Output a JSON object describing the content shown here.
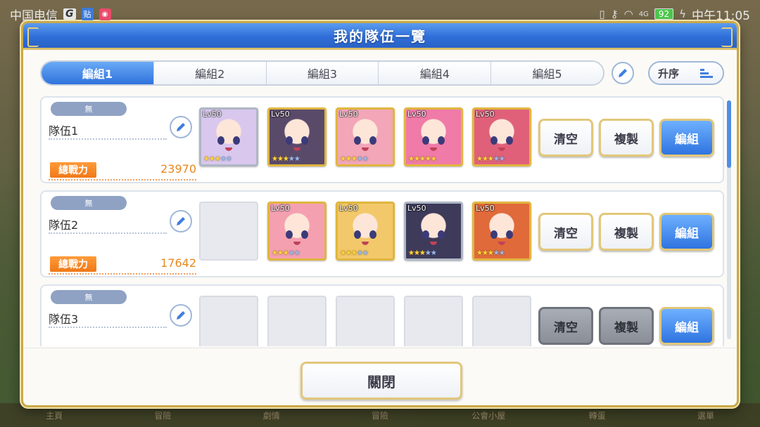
{
  "status_bar": {
    "carrier": "中国电信",
    "carrier_badge": "G",
    "tieba_badge": "贴",
    "record_badge": "◉",
    "signal_text": "4G",
    "battery": "92",
    "time": "中午11:05"
  },
  "bottom_nav": [
    "主頁",
    "冒險",
    "劇情",
    "冒險",
    "公會小屋",
    "轉蛋",
    "選單"
  ],
  "modal": {
    "title": "我的隊伍一覽",
    "close_label": "關閉"
  },
  "tabs": [
    {
      "label": "編組1",
      "active": true
    },
    {
      "label": "編組2",
      "active": false
    },
    {
      "label": "編組3",
      "active": false
    },
    {
      "label": "編組4",
      "active": false
    },
    {
      "label": "編組5",
      "active": false
    }
  ],
  "sort": {
    "label": "升序"
  },
  "teams": [
    {
      "attr": "無",
      "name": "隊伍1",
      "power_label": "總戰力",
      "power": "23970",
      "slots": [
        {
          "lv": "Lv50",
          "stars": 3,
          "frame": "silver",
          "color": "#d9c7ee"
        },
        {
          "lv": "Lv50",
          "stars": 3,
          "frame": "gold",
          "color": "#5a4a6a"
        },
        {
          "lv": "Lv50",
          "stars": 3,
          "frame": "gold",
          "color": "#f2a6b8"
        },
        {
          "lv": "Lv50",
          "stars": 5,
          "frame": "gold",
          "color": "#f07aa8"
        },
        {
          "lv": "Lv50",
          "stars": 3,
          "frame": "gold",
          "color": "#e0607a"
        }
      ],
      "buttons": {
        "clear": "清空",
        "copy": "複製",
        "edit": "編組"
      },
      "disabled": false
    },
    {
      "attr": "無",
      "name": "隊伍2",
      "power_label": "總戰力",
      "power": "17642",
      "slots": [
        null,
        {
          "lv": "Lv50",
          "stars": 3,
          "frame": "gold",
          "color": "#f4a0b0"
        },
        {
          "lv": "Lv50",
          "stars": 3,
          "frame": "gold",
          "color": "#f2c86a"
        },
        {
          "lv": "Lv50",
          "stars": 3,
          "frame": "silver",
          "color": "#3d3a5a"
        },
        {
          "lv": "Lv50",
          "stars": 3,
          "frame": "gold",
          "color": "#e06a3a"
        }
      ],
      "buttons": {
        "clear": "清空",
        "copy": "複製",
        "edit": "編組"
      },
      "disabled": false
    },
    {
      "attr": "無",
      "name": "隊伍3",
      "power_label": "",
      "power": "",
      "slots": [
        null,
        null,
        null,
        null,
        null
      ],
      "buttons": {
        "clear": "清空",
        "copy": "複製",
        "edit": "編組"
      },
      "disabled": true
    }
  ]
}
